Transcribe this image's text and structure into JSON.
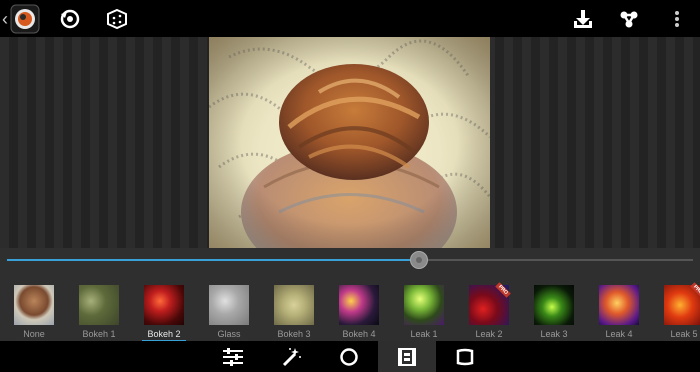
{
  "topbar": {
    "back_glyph": "‹",
    "icons": [
      "app-logo-icon",
      "history-icon",
      "random-dice-icon",
      "download-icon",
      "share-icon",
      "more-vert-icon"
    ]
  },
  "editor": {
    "intensity_percent": 60,
    "accent_color": "#3aa0d8"
  },
  "filters": {
    "selected": "Bokeh 2",
    "items": [
      {
        "label": "None"
      },
      {
        "label": "Bokeh 1"
      },
      {
        "label": "Bokeh 2"
      },
      {
        "label": "Glass"
      },
      {
        "label": "Bokeh 3"
      },
      {
        "label": "Bokeh 4"
      },
      {
        "label": "Leak 1"
      },
      {
        "label": "Leak 2",
        "pro": "PRO"
      },
      {
        "label": "Leak 3"
      },
      {
        "label": "Leak 4"
      },
      {
        "label": "Leak 5",
        "pro": "PRO"
      }
    ]
  },
  "bottombar": {
    "tools": [
      "adjust-sliders-icon",
      "magic-wand-icon",
      "vignette-circle-icon",
      "film-overlay-icon",
      "frame-border-icon"
    ],
    "active": "film-overlay-icon"
  }
}
